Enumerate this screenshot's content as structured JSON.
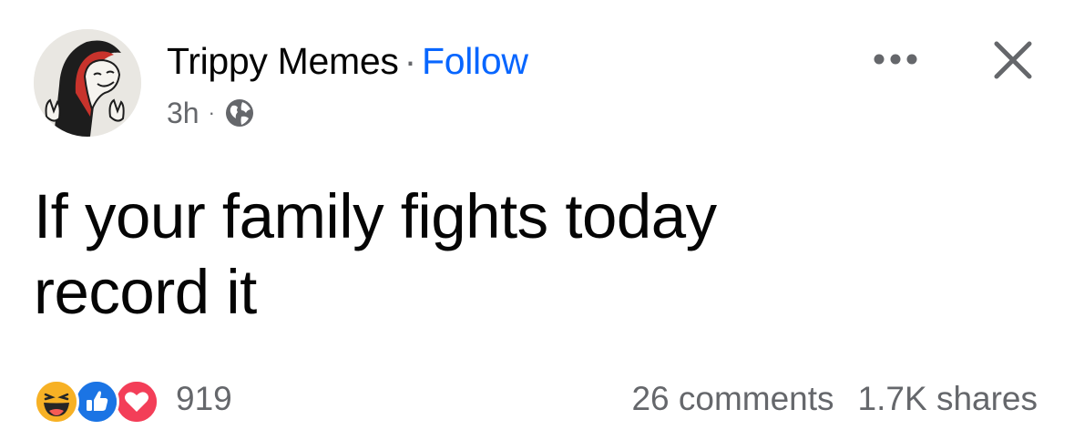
{
  "post": {
    "author": "Trippy Memes",
    "separator": "·",
    "follow_label": "Follow",
    "time": "3h",
    "meta_separator": "·",
    "audience_icon": "globe-icon",
    "text_line1": "If your family fights today",
    "text_line2": "record it",
    "reactions": {
      "icons": [
        "haha-icon",
        "like-icon",
        "love-icon"
      ],
      "count": "919"
    },
    "comments": "26 comments",
    "shares": "1.7K shares",
    "header_actions": [
      "more-options-icon",
      "close-icon"
    ]
  },
  "colors": {
    "link": "#0866ff",
    "secondary_text": "#65676b",
    "like": "#1b74e4",
    "love": "#f33e58",
    "haha": "#f7b125"
  }
}
